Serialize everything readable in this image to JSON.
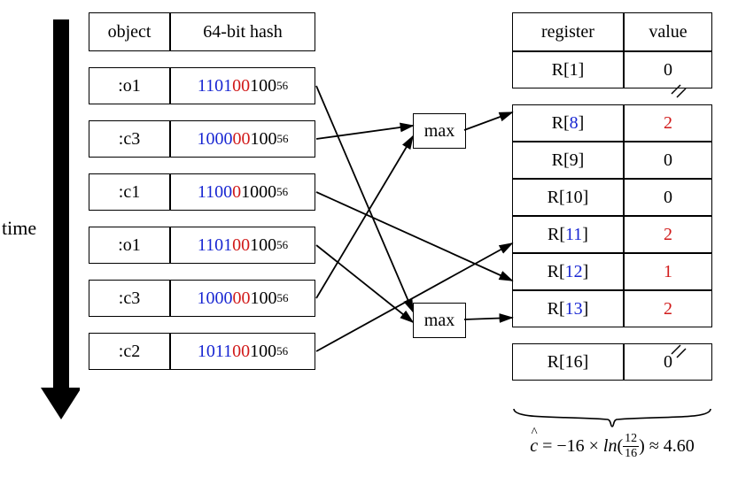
{
  "left_table": {
    "headers": {
      "object": "object",
      "hash": "64-bit hash"
    },
    "rows": [
      {
        "obj": ":o1",
        "hash_pre": "1101",
        "hash_mid": "00",
        "hash_post": "100",
        "hash_sup": "56"
      },
      {
        "obj": ":c3",
        "hash_pre": "1000",
        "hash_mid": "00",
        "hash_post": "100",
        "hash_sup": "56"
      },
      {
        "obj": ":c1",
        "hash_pre": "1100",
        "hash_mid": "0",
        "hash_post": "1000",
        "hash_sup": "56"
      },
      {
        "obj": ":o1",
        "hash_pre": "1101",
        "hash_mid": "00",
        "hash_post": "100",
        "hash_sup": "56"
      },
      {
        "obj": ":c3",
        "hash_pre": "1000",
        "hash_mid": "00",
        "hash_post": "100",
        "hash_sup": "56"
      },
      {
        "obj": ":c2",
        "hash_pre": "1011",
        "hash_mid": "00",
        "hash_post": "100",
        "hash_sup": "56"
      }
    ]
  },
  "time_label": "time",
  "max_label": "max",
  "right_table": {
    "headers": {
      "register": "register",
      "value": "value"
    },
    "rows": [
      {
        "reg_pre": "R[",
        "reg_idx": "1",
        "reg_post": "]",
        "val": "0",
        "idx_blue": false,
        "val_red": false
      },
      {
        "reg_pre": "R[",
        "reg_idx": "8",
        "reg_post": "]",
        "val": "2",
        "idx_blue": true,
        "val_red": true
      },
      {
        "reg_pre": "R[",
        "reg_idx": "9",
        "reg_post": "]",
        "val": "0",
        "idx_blue": false,
        "val_red": false
      },
      {
        "reg_pre": "R[",
        "reg_idx": "10",
        "reg_post": "]",
        "val": "0",
        "idx_blue": false,
        "val_red": false
      },
      {
        "reg_pre": "R[",
        "reg_idx": "11",
        "reg_post": "]",
        "val": "2",
        "idx_blue": true,
        "val_red": true
      },
      {
        "reg_pre": "R[",
        "reg_idx": "12",
        "reg_post": "]",
        "val": "1",
        "idx_blue": true,
        "val_red": true
      },
      {
        "reg_pre": "R[",
        "reg_idx": "13",
        "reg_post": "]",
        "val": "2",
        "idx_blue": true,
        "val_red": true
      },
      {
        "reg_pre": "R[",
        "reg_idx": "16",
        "reg_post": "]",
        "val": "0",
        "idx_blue": false,
        "val_red": false
      }
    ]
  },
  "formula": {
    "lhs_var": "c",
    "eq": " = ",
    "coeff": "−16 × ",
    "fn": "ln",
    "lparen": "(",
    "frac_num": "12",
    "frac_den": "16",
    "rparen": ")",
    "approx": " ≈ 4.60"
  }
}
